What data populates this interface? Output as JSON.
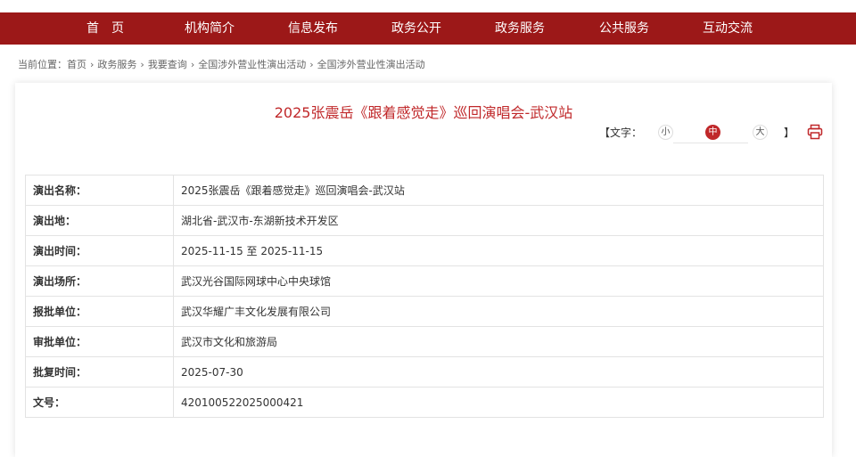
{
  "nav": [
    "首　页",
    "机构简介",
    "信息发布",
    "政务公开",
    "政务服务",
    "公共服务",
    "互动交流"
  ],
  "breadcrumb": {
    "label": "当前位置：",
    "items": [
      "首页",
      "政务服务",
      "我要查询",
      "全国涉外营业性演出活动",
      "全国涉外营业性演出活动"
    ],
    "sep": "›"
  },
  "title": "2025张震岳《跟着感觉走》巡回演唱会-武汉站",
  "font_control": {
    "open": "【文字：",
    "small": "小",
    "medium": "中",
    "large": "大",
    "close": "】",
    "print_icon": "printer-icon"
  },
  "colors": {
    "nav": "#9c1818",
    "accent": "#c0282a"
  },
  "rows": [
    {
      "k": "演出名称：",
      "v": "2025张震岳《跟着感觉走》巡回演唱会-武汉站"
    },
    {
      "k": "演出地：",
      "v": "湖北省-武汉市-东湖新技术开发区"
    },
    {
      "k": "演出时间：",
      "v": "2025-11-15 至 2025-11-15"
    },
    {
      "k": "演出场所：",
      "v": "武汉光谷国际网球中心中央球馆"
    },
    {
      "k": "报批单位：",
      "v": "武汉华耀广丰文化发展有限公司"
    },
    {
      "k": "审批单位：",
      "v": "武汉市文化和旅游局"
    },
    {
      "k": "批复时间：",
      "v": "2025-07-30"
    },
    {
      "k": "文号：",
      "v": "420100522025000421"
    }
  ]
}
